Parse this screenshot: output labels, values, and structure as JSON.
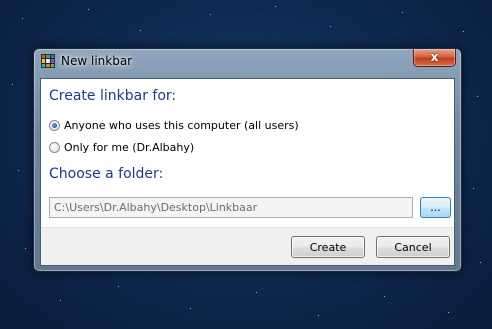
{
  "window": {
    "title": "New linkbar",
    "close_label": "x"
  },
  "section_users": {
    "heading": "Create linkbar for:",
    "options": [
      {
        "label": "Anyone who uses this computer (all users)",
        "checked": true
      },
      {
        "label": "Only for me (Dr.Albahy)",
        "checked": false
      }
    ]
  },
  "section_folder": {
    "heading": "Choose a folder:",
    "path_value": "C:\\Users\\Dr.Albahy\\Desktop\\Linkbaar",
    "browse_label": "..."
  },
  "footer": {
    "create_label": "Create",
    "cancel_label": "Cancel"
  },
  "icons": {
    "app": "linkbar-grid-icon",
    "close": "close-icon"
  },
  "colors": {
    "heading": "#1e3a8a",
    "close_button": "#c2401b",
    "browse_button_border": "#3c7fb1",
    "radio_checked": "#1f5fb5"
  }
}
